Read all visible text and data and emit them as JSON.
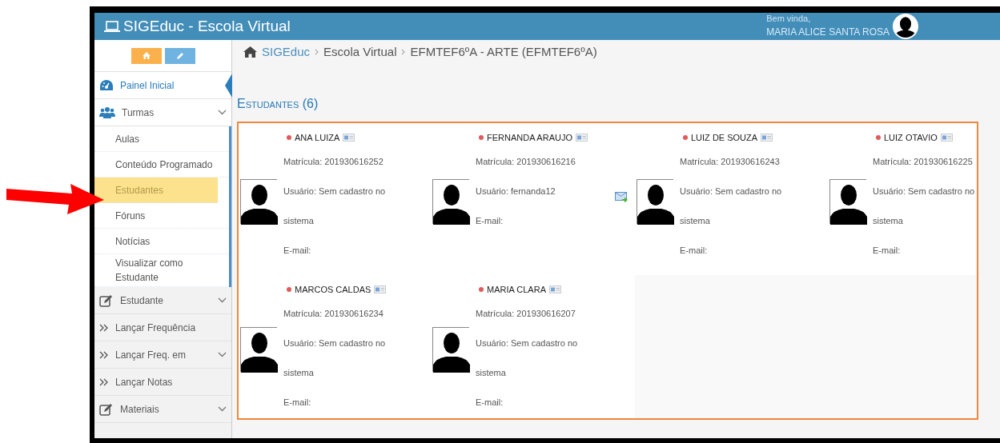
{
  "header": {
    "title": "SIGEduc - Escola Virtual",
    "greeting": "Bem vinda,",
    "user_name": "MARIA ALICE SANTA ROSA"
  },
  "sidebar": {
    "items": [
      {
        "label": "Painel Inicial",
        "kind": "dashboard",
        "selected": true
      },
      {
        "label": "Turmas",
        "kind": "users",
        "selected": false,
        "expanded": true,
        "children": [
          {
            "label": "Aulas",
            "selected": false
          },
          {
            "label": "Conteúdo Programado",
            "selected": false
          },
          {
            "label": "Estudantes",
            "selected": true
          },
          {
            "label": "Fóruns",
            "selected": false
          },
          {
            "label": "Notícias",
            "selected": false
          },
          {
            "label": "Visualizar como Estudante",
            "selected": false
          }
        ]
      },
      {
        "label": "Estudante",
        "kind": "edit",
        "selected": false,
        "expanded": false
      },
      {
        "label": "Lançar Frequência",
        "kind": "chevrons",
        "selected": false
      },
      {
        "label": "Lançar Freq. em",
        "kind": "chevrons",
        "selected": false,
        "expanded": false
      },
      {
        "label": "Lançar Notas",
        "kind": "chevrons",
        "selected": false
      },
      {
        "label": "Materiais",
        "kind": "edit",
        "selected": false,
        "expanded": false
      }
    ]
  },
  "breadcrumb": [
    "SIGEduc",
    "Escola Virtual",
    "EFMTEF6ºA - ARTE (EFMTEF6ºA)"
  ],
  "section_title": "Estudantes (6)",
  "students": [
    {
      "name": "ANA LUIZA",
      "color": "#e05a5a",
      "matricula": "Matrícula: 201930616252",
      "usuario": "Usuário: Sem cadastro no sistema",
      "email": "E-mail:",
      "mail_icon": false
    },
    {
      "name": "FERNANDA ARAUJO",
      "color": "#e05a5a",
      "matricula": "Matrícula: 201930616216",
      "usuario": "Usuário: fernanda12",
      "email": "E-mail:",
      "mail_icon": true
    },
    {
      "name": "LUIZ DE SOUZA",
      "color": "#e05a5a",
      "matricula": "Matrícula: 201930616243",
      "usuario": "Usuário: Sem cadastro no sistema",
      "email": "E-mail:",
      "mail_icon": false
    },
    {
      "name": "LUIZ OTAVIO",
      "color": "#e05a5a",
      "matricula": "Matrícula: 201930616225",
      "usuario": "Usuário: Sem cadastro no sistema",
      "email": "E-mail:",
      "mail_icon": false
    },
    {
      "name": "MARCOS CALDAS",
      "color": "#e05a5a",
      "matricula": "Matrícula: 201930616234",
      "usuario": "Usuário: Sem cadastro no sistema",
      "email": "E-mail:",
      "mail_icon": false
    },
    {
      "name": "MARIA CLARA",
      "color": "#e05a5a",
      "matricula": "Matrícula: 201930616207",
      "usuario": "Usuário: Sem cadastro no sistema",
      "email": "E-mail:",
      "mail_icon": false
    }
  ]
}
